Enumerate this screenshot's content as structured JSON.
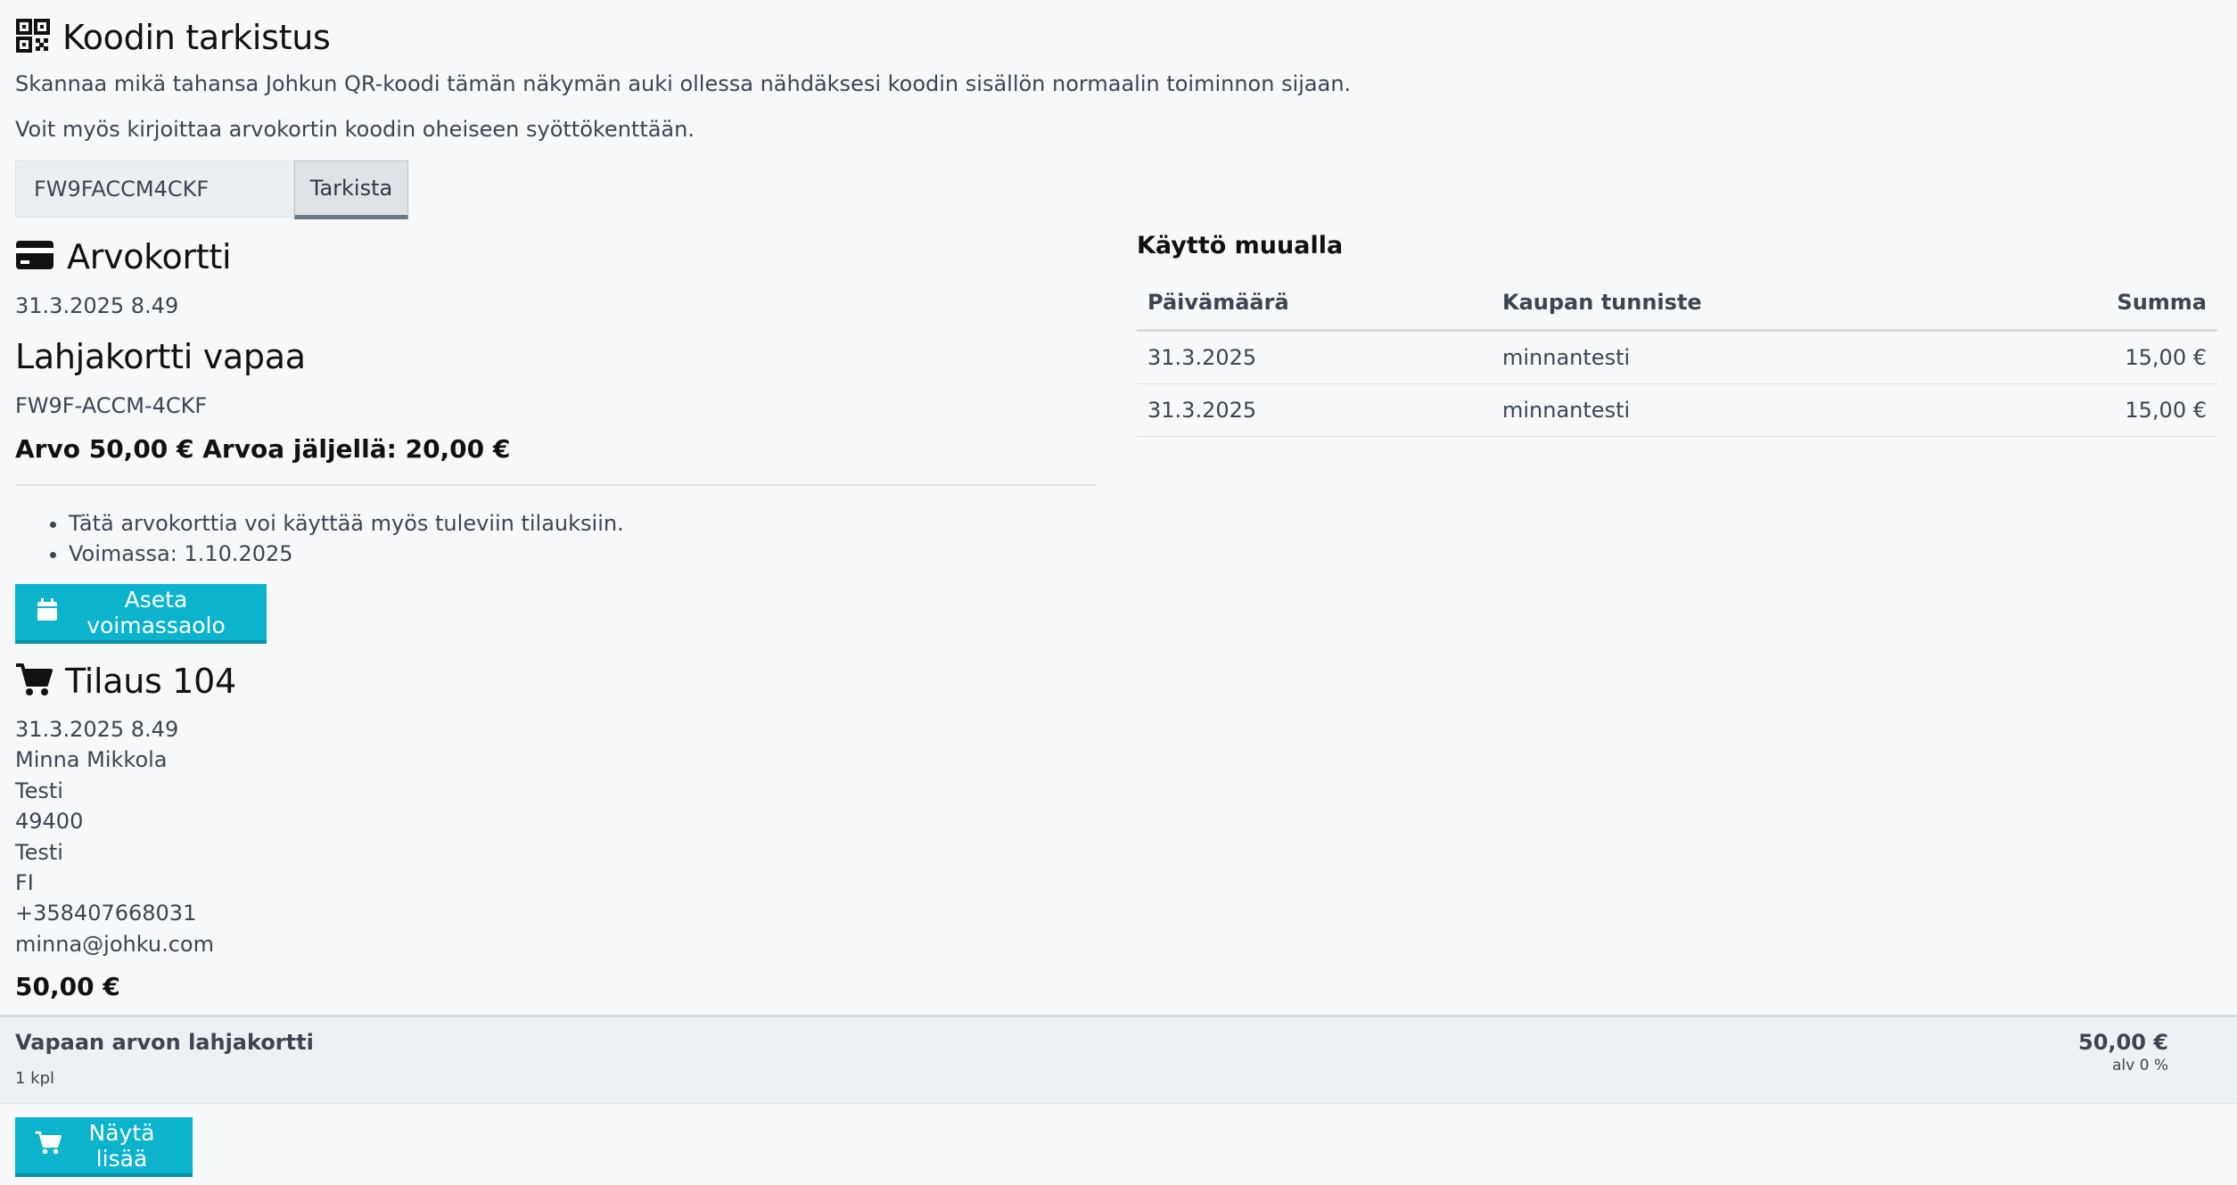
{
  "header": {
    "icon": "qr-code-icon",
    "title": "Koodin tarkistus",
    "description": "Skannaa mikä tahansa Johkun QR-koodi tämän näkymän auki ollessa nähdäksesi koodin sisällön normaalin toiminnon sijaan.",
    "hint": "Voit myös kirjoittaa arvokortin koodin oheiseen syöttökenttään."
  },
  "search": {
    "value": "FW9FACCM4CKF",
    "button_label": "Tarkista"
  },
  "voucher": {
    "icon": "credit-card-icon",
    "title": "Arvokortti",
    "datetime": "31.3.2025 8.49",
    "name": "Lahjakortti vapaa",
    "code": "FW9F-ACCM-4CKF",
    "value_text": "Arvo 50,00 € Arvoa jäljellä: 20,00 €",
    "info": [
      "Tätä arvokorttia voi käyttää myös tuleviin tilauksiin.",
      "Voimassa: 1.10.2025"
    ],
    "set_validity_label": "Aseta voimassaolo"
  },
  "usage": {
    "title": "Käyttö muualla",
    "columns": [
      "Päivämäärä",
      "Kaupan tunniste",
      "Summa"
    ],
    "rows": [
      [
        "31.3.2025",
        "minnantesti",
        "15,00 €"
      ],
      [
        "31.3.2025",
        "minnantesti",
        "15,00 €"
      ]
    ]
  },
  "order": {
    "icon": "shopping-cart-icon",
    "title": "Tilaus 104",
    "datetime": "31.3.2025 8.49",
    "customer": [
      "Minna Mikkola",
      "Testi",
      "49400",
      "Testi",
      "FI",
      "+358407668031",
      "minna@johku.com"
    ],
    "total": "50,00 €",
    "item": {
      "name": "Vapaan arvon lahjakortti",
      "qty": "1 kpl",
      "price": "50,00 €",
      "vat": "alv 0 %"
    },
    "more_label": "Näytä lisää"
  },
  "colors": {
    "accent": "#0bb3cc",
    "background": "#f7f8fa",
    "text": "#2d3a45"
  }
}
